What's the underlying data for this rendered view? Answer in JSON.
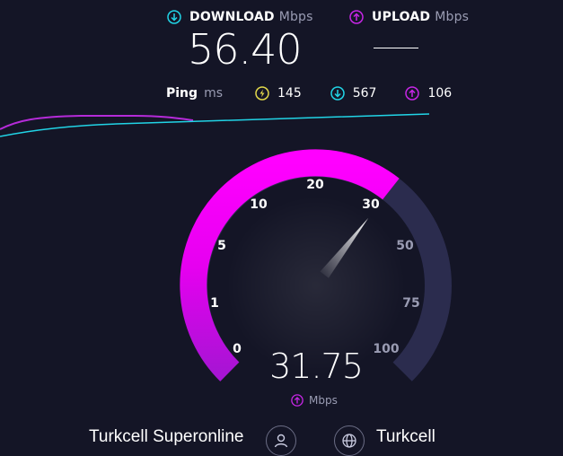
{
  "download": {
    "label": "DOWNLOAD",
    "unit": "Mbps",
    "value": "56.40"
  },
  "upload": {
    "label": "UPLOAD",
    "unit": "Mbps",
    "value": "—"
  },
  "ping": {
    "label": "Ping",
    "unit": "ms",
    "idle": "145",
    "download": "567",
    "upload": "106"
  },
  "gauge": {
    "ticks": [
      "0",
      "1",
      "5",
      "10",
      "20",
      "30",
      "50",
      "75",
      "100"
    ],
    "reading": "31.75",
    "unit": "Mbps",
    "fill_fraction": 0.64
  },
  "footer": {
    "isp": "Turkcell Superonline",
    "server": "Turkcell"
  },
  "colors": {
    "download": "#21d4e6",
    "upload": "#c726e6",
    "gauge_fill": "#ff00ff",
    "gauge_track": "#2b2c4e",
    "ping_idle": "#e3d94b"
  },
  "icons": {
    "download": "download-arrow-icon",
    "upload": "upload-arrow-icon",
    "ping": "lightning-icon",
    "user": "user-icon",
    "globe": "globe-icon"
  }
}
